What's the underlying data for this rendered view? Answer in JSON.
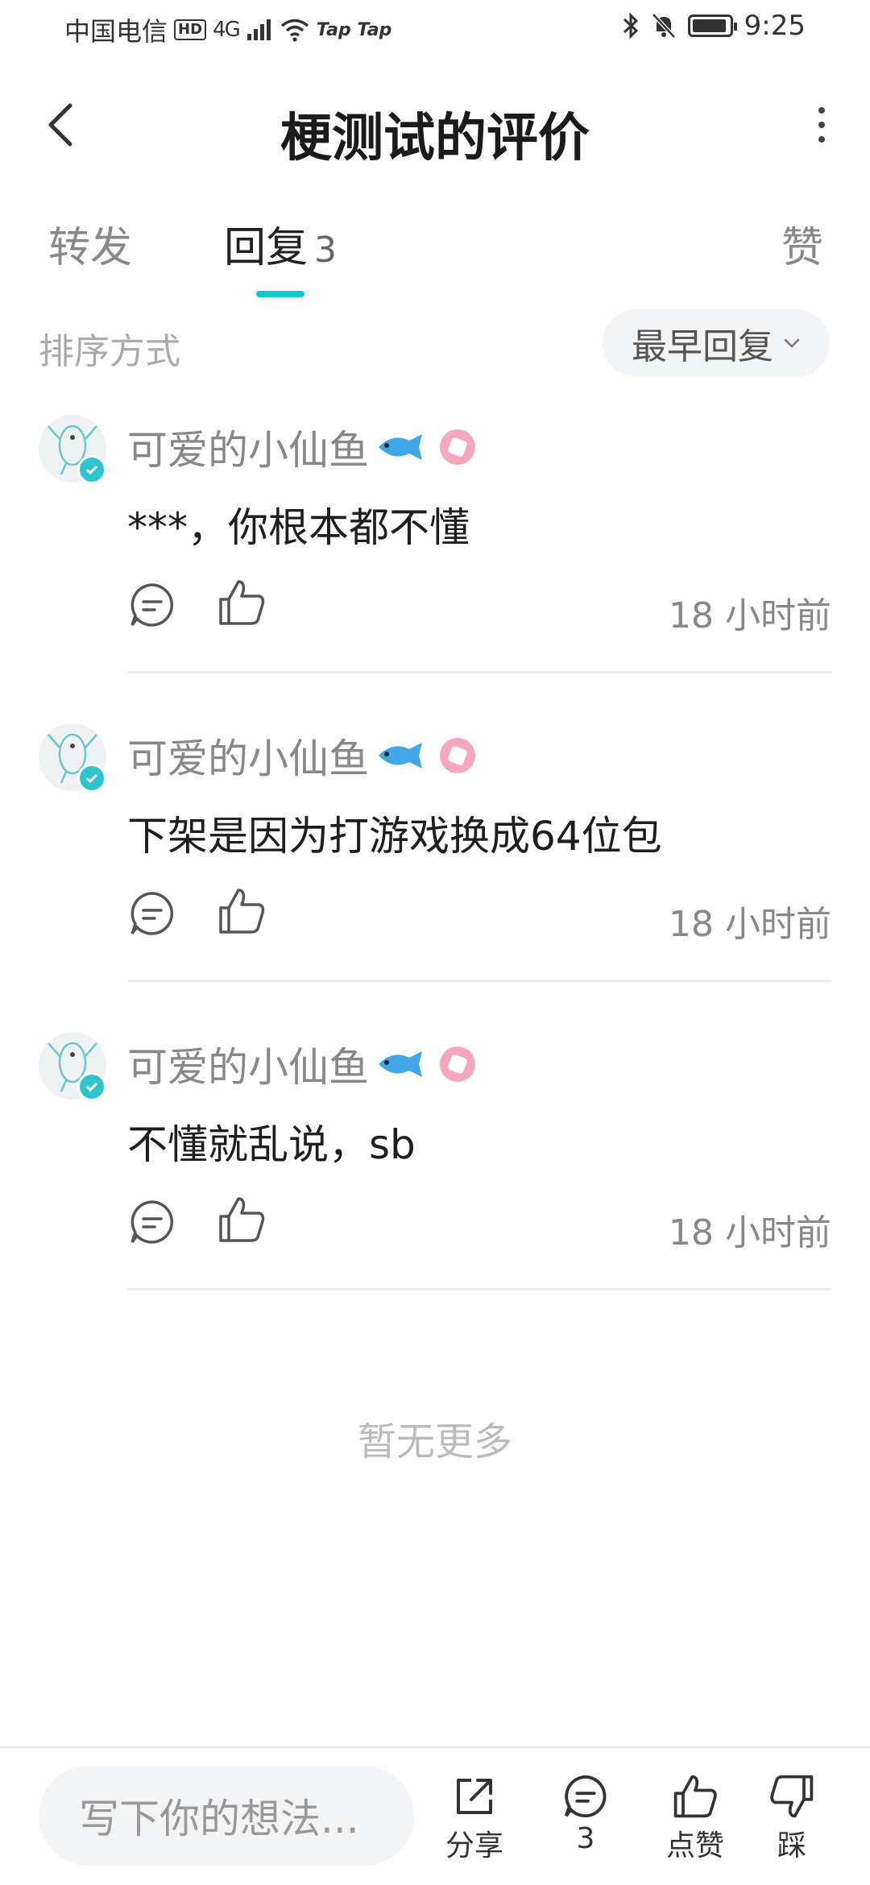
{
  "status_bar": {
    "carrier": "中国电信",
    "hd": "HD",
    "network": "4G",
    "extra": "Tap Tap",
    "time": "9:25"
  },
  "header": {
    "title": "梗测试的评价"
  },
  "tabs": [
    {
      "label": "转发"
    },
    {
      "label": "回复",
      "count": "3"
    },
    {
      "label": "赞"
    }
  ],
  "sort": {
    "label": "排序方式",
    "selected": "最早回复"
  },
  "comments": [
    {
      "username": "可爱的小仙鱼",
      "text": "***，你根本都不懂",
      "time": "18 小时前"
    },
    {
      "username": "可爱的小仙鱼",
      "text": "下架是因为打游戏换成64位包",
      "time": "18 小时前"
    },
    {
      "username": "可爱的小仙鱼",
      "text": "不懂就乱说，sb",
      "time": "18 小时前"
    }
  ],
  "no_more": "暂无更多",
  "bottom_bar": {
    "input_placeholder": "写下你的想法...",
    "share_label": "分享",
    "comment_count": "3",
    "like_label": "点赞",
    "dislike_label": "踩"
  },
  "colors": {
    "accent": "#15c5ce",
    "badge_pink": "#f6a7bd"
  }
}
